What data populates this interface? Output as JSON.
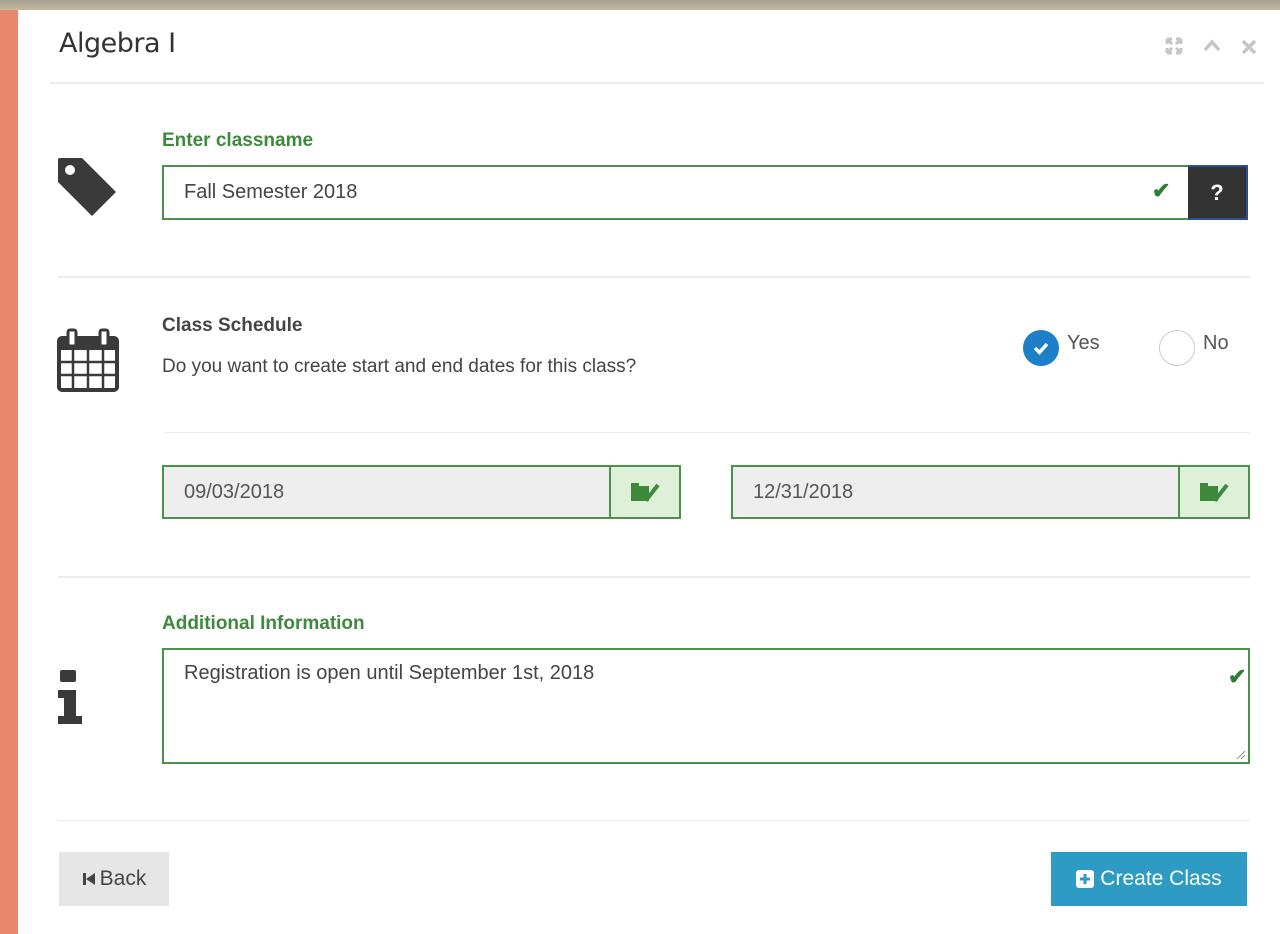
{
  "window": {
    "title": "Algebra I",
    "controls": {
      "expand_icon": "expand-icon",
      "collapse_icon": "chevron-up-icon",
      "close_icon": "close-icon"
    }
  },
  "classname": {
    "label": "Enter classname",
    "value": "Fall Semester 2018",
    "icon": "tag-icon",
    "help_label": "?",
    "valid": true
  },
  "schedule": {
    "label": "Class Schedule",
    "question": "Do you want to create start and end dates for this class?",
    "icon": "calendar-icon",
    "options": [
      {
        "label": "Yes",
        "selected": true
      },
      {
        "label": "No",
        "selected": false
      }
    ],
    "start_date": "09/03/2018",
    "end_date": "12/31/2018"
  },
  "additional": {
    "label": "Additional Information",
    "value": "Registration is open until September 1st, 2018",
    "icon": "info-icon",
    "valid": true
  },
  "footer": {
    "back_label": "Back",
    "create_label": "Create Class"
  },
  "colors": {
    "accent_green": "#3d8a3d",
    "primary_blue": "#2d9bc4",
    "radio_blue": "#1e7fc9"
  }
}
